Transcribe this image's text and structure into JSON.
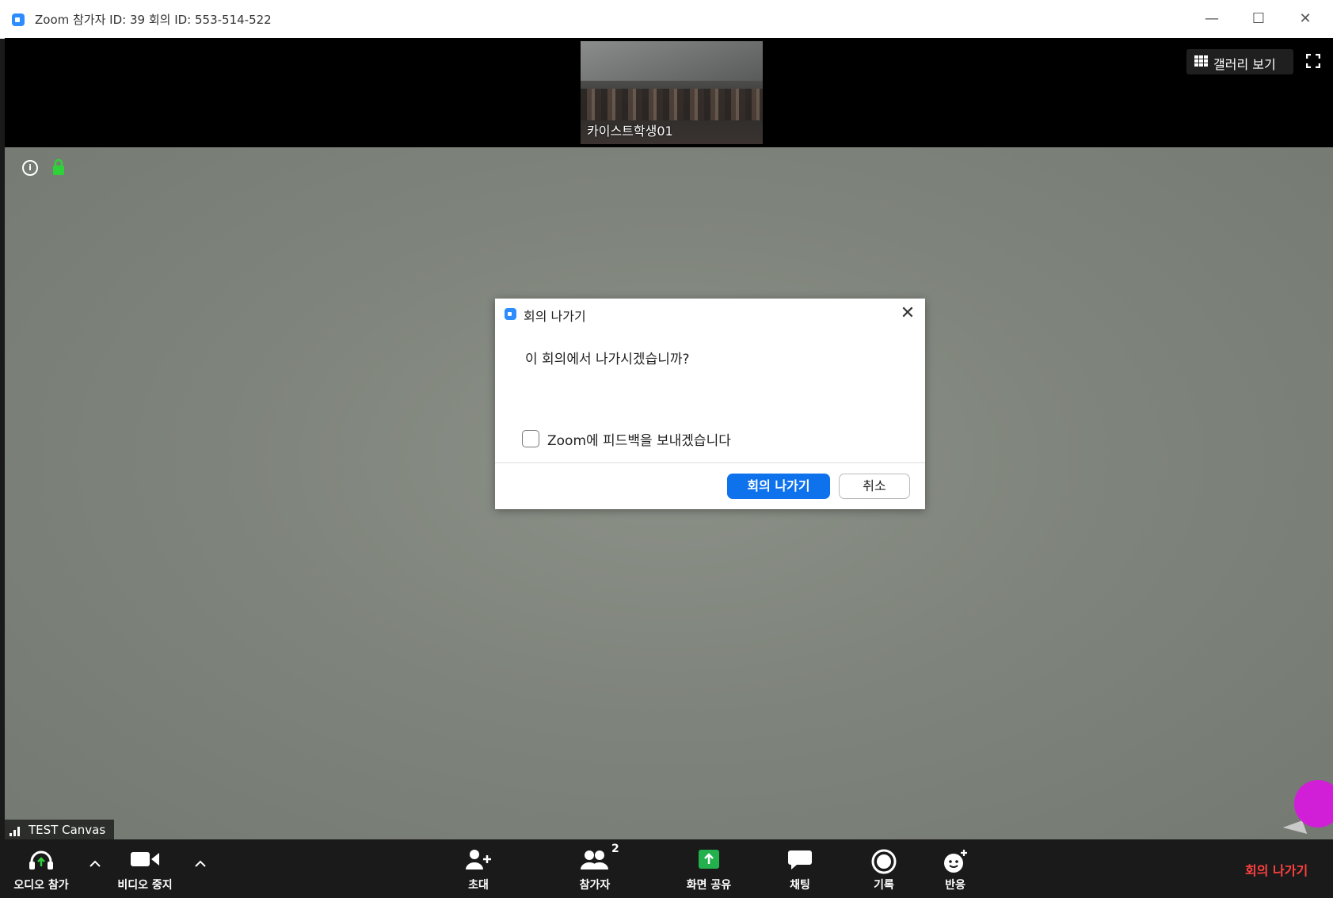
{
  "window": {
    "title": "Zoom 참가자 ID: 39   회의 ID: 553-514-522",
    "minimize": "—",
    "maximize": "☐",
    "close": "✕"
  },
  "top_strip": {
    "participant_thumb_name": "카이스트학생01",
    "gallery_view_label": "갤러리 보기"
  },
  "video": {
    "canvas_label": "TEST Canvas"
  },
  "toolbar": {
    "audio_label": "오디오 참가",
    "video_label": "비디오 중지",
    "invite_label": "초대",
    "participants_label": "참가자",
    "participants_count": "2",
    "share_label": "화면 공유",
    "chat_label": "채팅",
    "record_label": "기록",
    "reactions_label": "반응",
    "leave_label": "회의 나가기"
  },
  "dialog": {
    "title": "회의 나가기",
    "message": "이 회의에서 나가시겠습니까?",
    "checkbox_label": "Zoom에 피드백을 보내겠습니다",
    "leave_button": "회의 나가기",
    "cancel_button": "취소",
    "close": "✕"
  },
  "colors": {
    "accent": "#0e72ed",
    "leave_red": "#ff4040",
    "share_green": "#23b14d"
  }
}
